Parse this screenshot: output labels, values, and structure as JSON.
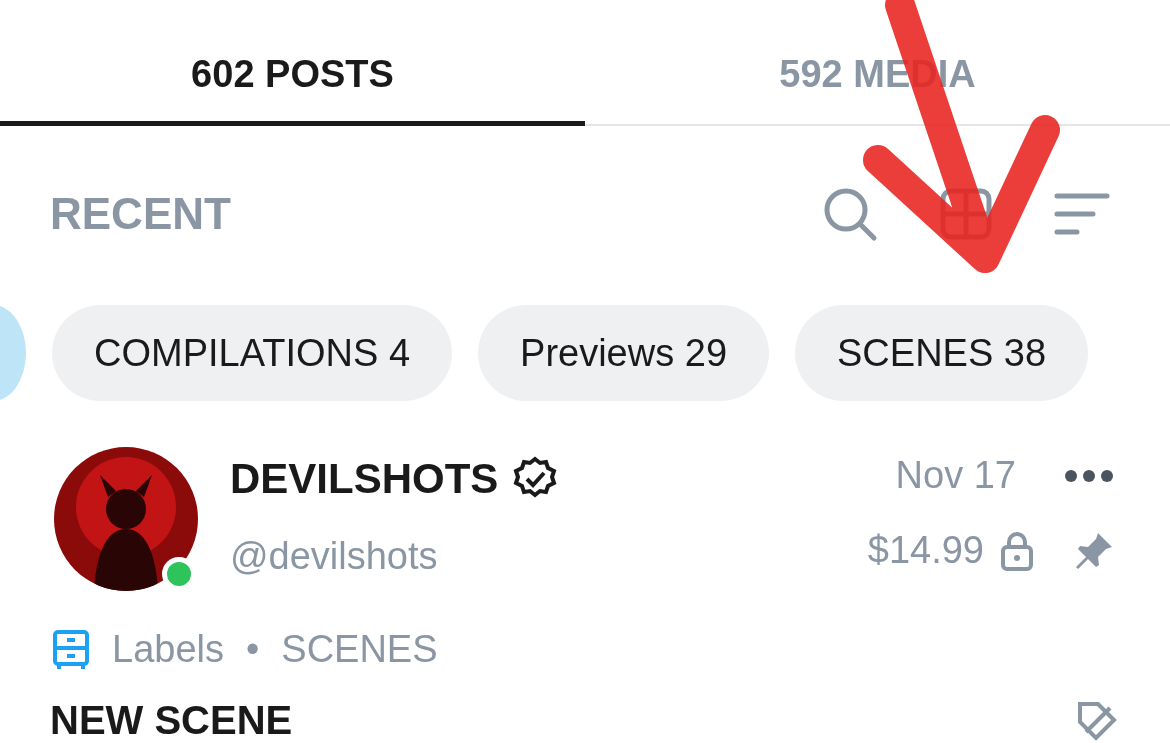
{
  "tabs": [
    {
      "label": "602 POSTS",
      "selected": true
    },
    {
      "label": "592 MEDIA",
      "selected": false
    }
  ],
  "section_title": "RECENT",
  "filters": [
    {
      "label": "COMPILATIONS 4"
    },
    {
      "label": "Previews 29"
    },
    {
      "label": "SCENES 38"
    }
  ],
  "post": {
    "author": "DEVILSHOTS",
    "verified": true,
    "handle": "@devilshots",
    "online": true,
    "date": "Nov 17",
    "price": "$14.99",
    "locked": true,
    "labels_label": "Labels",
    "separator": "•",
    "label_tag": "SCENES",
    "title": "NEW SCENE"
  },
  "annotation": {
    "kind": "arrow"
  }
}
